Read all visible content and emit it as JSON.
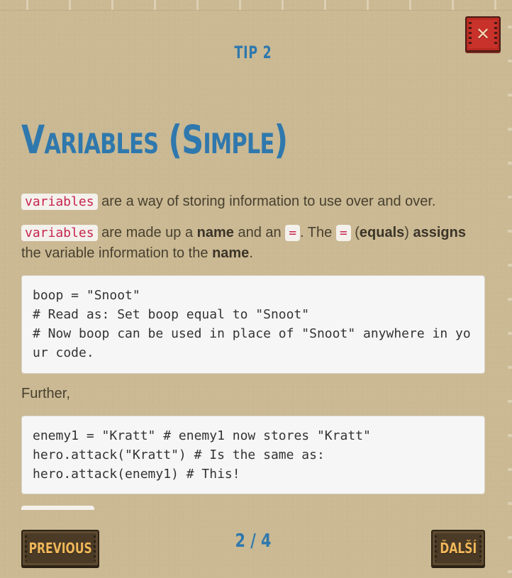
{
  "dialog": {
    "tip_label": "TIP 2",
    "title": "Variables (Simple)",
    "close_label": "✕"
  },
  "content": {
    "p1": {
      "code": "variables",
      "text": "are a way of storing information to use over and over."
    },
    "p2": {
      "code": "variables",
      "t1": "are made up a",
      "name_bold": "name",
      "t2": "and an",
      "eq_code": "=",
      "t3": ". The",
      "eq_code2": "=",
      "t4_open": "(",
      "equals_bold": "equals",
      "t4_close": ")",
      "assigns_bold": "assigns",
      "t5": "the variable information to the",
      "name_bold2": "name",
      "t6": "."
    },
    "code1": "boop = \"Snoot\"\n# Read as: Set boop equal to \"Snoot\"\n# Now boop can be used in place of \"Snoot\" anywhere in your code.",
    "further": "Further,",
    "code2": "enemy1 = \"Kratt\" # enemy1 now stores \"Kratt\"\nhero.attack(\"Kratt\") # Is the same as:\nhero.attack(enemy1) # This!"
  },
  "footer": {
    "previous_label": "PREVIOUS",
    "page_indicator": "2 / 4",
    "next_label": "ĎALŠÍ"
  },
  "colors": {
    "background": "#cab993",
    "accent_blue": "#2f78ad",
    "close_red": "#c8322a",
    "button_brown": "#4b3b26",
    "button_text": "#f0b75a",
    "inline_code_text": "#c7254e"
  }
}
